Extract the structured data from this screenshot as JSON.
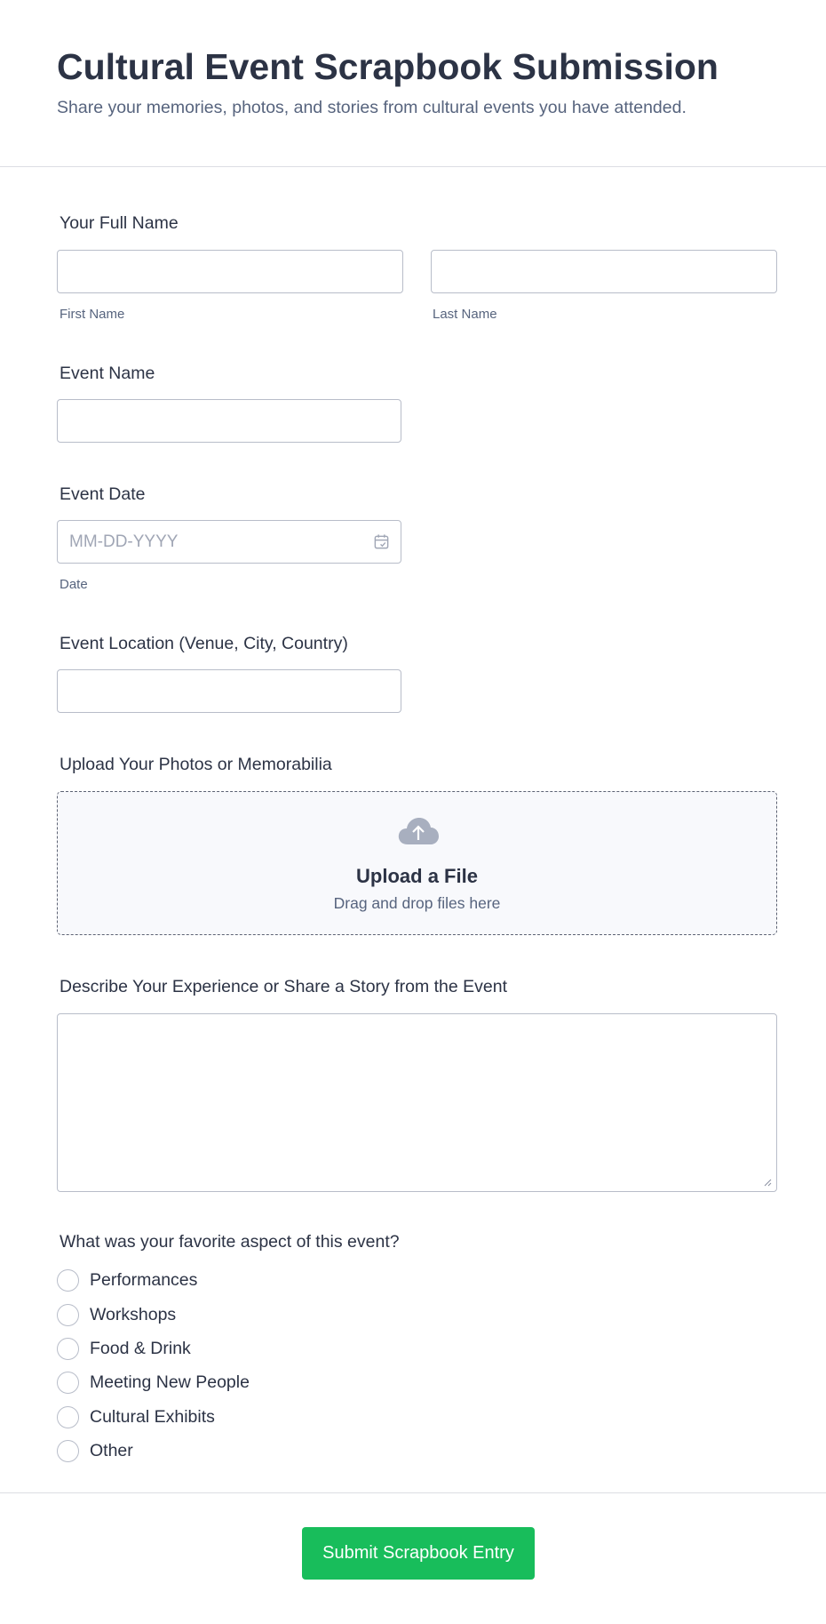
{
  "form": {
    "title": "Cultural Event Scrapbook Submission",
    "subtitle": "Share your memories, photos, and stories from cultural events you have attended."
  },
  "full_name": {
    "label": "Your Full Name",
    "first": {
      "value": "",
      "sublabel": "First Name"
    },
    "last": {
      "value": "",
      "sublabel": "Last Name"
    }
  },
  "event_name": {
    "label": "Event Name",
    "value": ""
  },
  "event_date": {
    "label": "Event Date",
    "placeholder": "MM-DD-YYYY",
    "sublabel": "Date",
    "icon": "calendar-icon"
  },
  "event_location": {
    "label": "Event Location (Venue, City, Country)",
    "value": ""
  },
  "upload": {
    "label": "Upload Your Photos or Memorabilia",
    "title": "Upload a File",
    "subtitle": "Drag and drop files here",
    "icon": "cloud-upload-icon"
  },
  "story": {
    "label": "Describe Your Experience or Share a Story from the Event",
    "value": ""
  },
  "favorite": {
    "label": "What was your favorite aspect of this event?",
    "options": [
      "Performances",
      "Workshops",
      "Food & Drink",
      "Meeting New People",
      "Cultural Exhibits",
      "Other"
    ]
  },
  "submit": {
    "label": "Submit Scrapbook Entry"
  },
  "colors": {
    "submit_bg": "#18bd5b",
    "text_primary": "#2c3345",
    "text_secondary": "#57647e",
    "border": "#b8bdc9"
  }
}
